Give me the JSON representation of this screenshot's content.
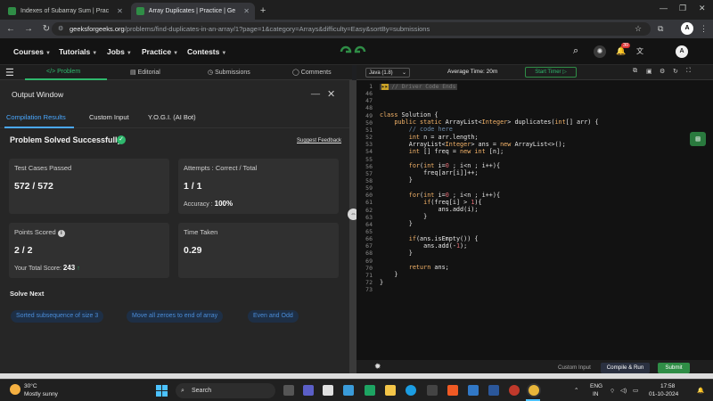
{
  "browser": {
    "tabs": [
      {
        "title": "Indexes of Subarray Sum | Prac",
        "active": false
      },
      {
        "title": "Array Duplicates | Practice | Ge",
        "active": true
      }
    ],
    "url_host": "geeksforgeeks.org",
    "url_path": "/problems/find-duplicates-in-an-array/1?page=1&category=Arrays&difficulty=Easy&sortBy=submissions",
    "profile_initial": "A",
    "notification_count": "30"
  },
  "site": {
    "nav": [
      "Courses",
      "Tutorials",
      "Jobs",
      "Practice",
      "Contests"
    ],
    "logo_text": "GfG",
    "accent": "#2f8d46"
  },
  "left_tabs": [
    "Problem",
    "Editorial",
    "Submissions",
    "Comments"
  ],
  "output": {
    "title": "Output Window",
    "minimize": "__",
    "close": "✕",
    "tabs": [
      "Compilation Results",
      "Custom Input",
      "Y.O.G.I. (AI Bot)"
    ],
    "status": "Problem Solved Successfully",
    "feedback_link": "Suggest Feedback",
    "test_cases_label": "Test Cases Passed",
    "test_cases_value": "572 / 572",
    "attempts_label": "Attempts : Correct / Total",
    "attempts_value": "1 / 1",
    "accuracy_label": "Accuracy :",
    "accuracy_value": "100%",
    "points_label": "Points Scored",
    "points_value": "2 / 2",
    "total_score_label": "Your Total Score:",
    "total_score_value": "243",
    "time_label": "Time Taken",
    "time_value": "0.29",
    "solve_next_label": "Solve Next",
    "solve_next": [
      "Sorted subsequence of size 3",
      "Move all zeroes to end of array",
      "Even and Odd"
    ]
  },
  "editor": {
    "language": "Java (1.8)",
    "average_time_label": "Average Time:",
    "average_time_value": "20m",
    "start_timer": "Start Timer",
    "folded_comment": "// Driver Code Ends",
    "lines": [
      {
        "n": "1",
        "text": ""
      },
      {
        "n": "46",
        "text": ""
      },
      {
        "n": "47",
        "text": ""
      },
      {
        "n": "48",
        "text": ""
      },
      {
        "n": "49",
        "text": "class Solution {"
      },
      {
        "n": "50",
        "text": "    public static ArrayList<Integer> duplicates(int[] arr) {"
      },
      {
        "n": "51",
        "text": "        // code here"
      },
      {
        "n": "52",
        "text": "        int n = arr.length;"
      },
      {
        "n": "53",
        "text": "        ArrayList<Integer> ans = new ArrayList<>();"
      },
      {
        "n": "54",
        "text": "        int [] freq = new int [n];"
      },
      {
        "n": "55",
        "text": ""
      },
      {
        "n": "56",
        "text": "        for(int i=0 ; i<n ; i++){"
      },
      {
        "n": "57",
        "text": "            freq[arr[i]]++;"
      },
      {
        "n": "58",
        "text": "        }"
      },
      {
        "n": "59",
        "text": ""
      },
      {
        "n": "60",
        "text": "        for(int i=0 ; i<n ; i++){"
      },
      {
        "n": "61",
        "text": "            if(freq[i] > 1){"
      },
      {
        "n": "62",
        "text": "                ans.add(i);"
      },
      {
        "n": "63",
        "text": "            }"
      },
      {
        "n": "64",
        "text": "        }"
      },
      {
        "n": "65",
        "text": ""
      },
      {
        "n": "66",
        "text": "        if(ans.isEmpty()) {"
      },
      {
        "n": "67",
        "text": "            ans.add(-1);"
      },
      {
        "n": "68",
        "text": "        }"
      },
      {
        "n": "69",
        "text": ""
      },
      {
        "n": "70",
        "text": "        return ans;"
      },
      {
        "n": "71",
        "text": "    }"
      },
      {
        "n": "72",
        "text": "}"
      },
      {
        "n": "73",
        "text": ""
      }
    ],
    "custom_input": "Custom Input",
    "compile_run": "Compile & Run",
    "submit": "Submit"
  },
  "taskbar": {
    "weather_temp": "30°C",
    "weather_desc": "Mostly sunny",
    "search_placeholder": "Search",
    "lang_top": "ENG",
    "lang_bottom": "IN",
    "time": "17:58",
    "date": "01-10-2024"
  }
}
